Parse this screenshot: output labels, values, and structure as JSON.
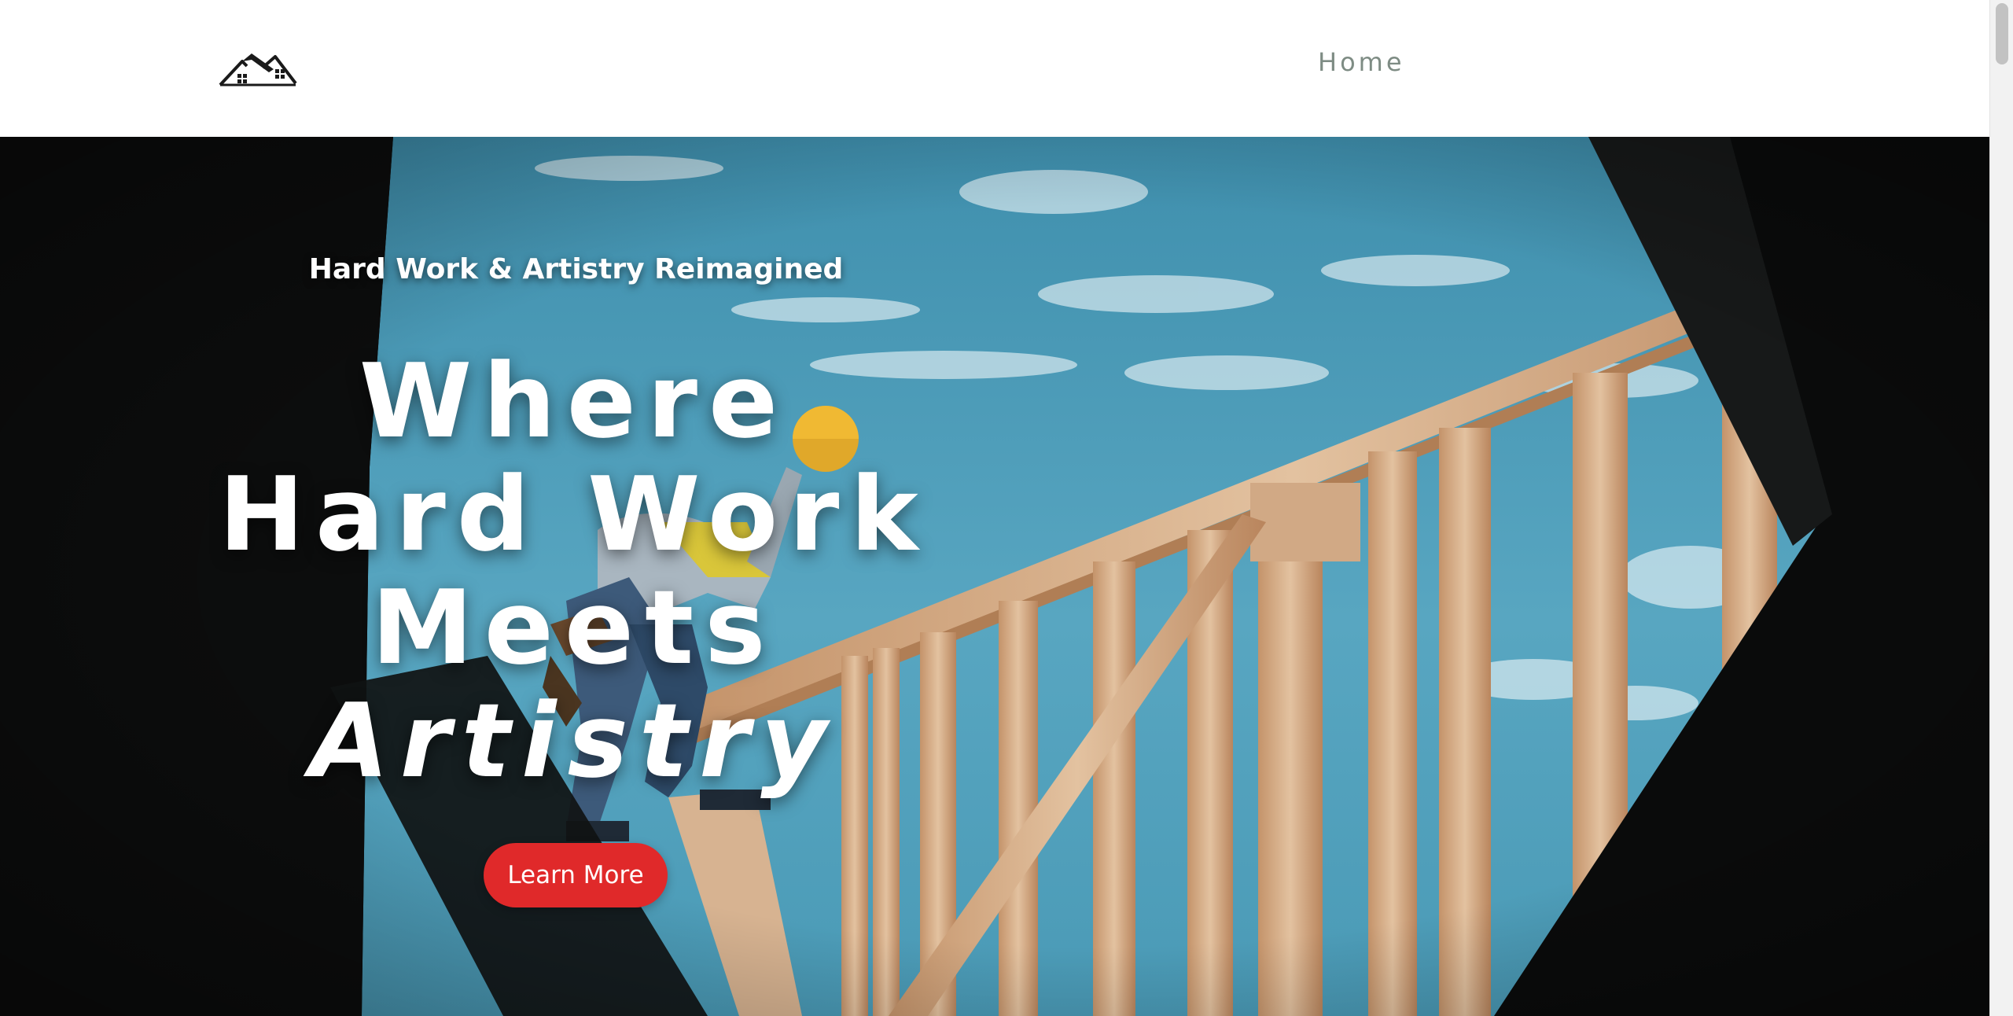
{
  "header": {
    "logo_icon": "house-roof-logo-icon",
    "nav": {
      "home_label": "Home"
    }
  },
  "hero": {
    "eyebrow": "Hard Work & Artistry Reimagined",
    "title_lines": [
      "Where",
      "Hard Work",
      "Meets",
      "Artistry"
    ],
    "cta_label": "Learn More",
    "background_image": "construction-worker-on-wood-frame-photo"
  },
  "colors": {
    "nav_text": "#7e8c84",
    "cta_background": "#e0292a",
    "cta_text": "#ffffff",
    "hero_text": "#ffffff",
    "sky": "#4e9cb6",
    "lumber": "#d8b08a"
  }
}
